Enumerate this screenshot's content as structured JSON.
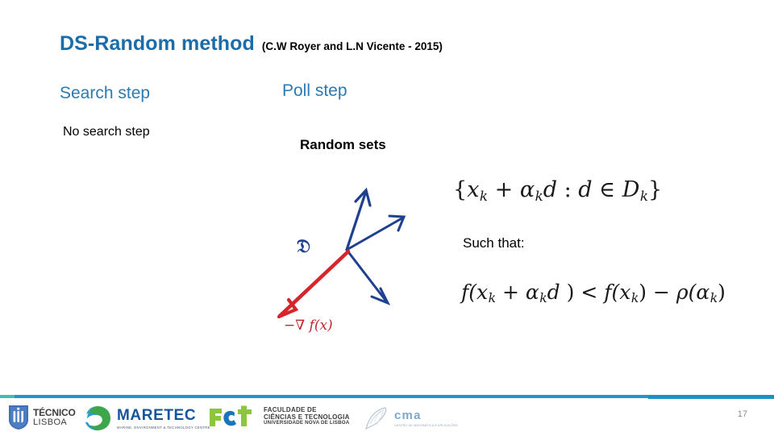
{
  "slide": {
    "title_main": "DS-Random method",
    "title_citation": "(C.W Royer and L.N Vicente - 2015)",
    "page_number": "17",
    "accent_blue": "#1b6ca8",
    "heading_blue": "#2b7ab0",
    "rule_teal": "#3fbfae",
    "rule_blue": "#2196c8",
    "arrow_blue": "#1f3f8f",
    "arrow_red": "#c0272d"
  },
  "columns": {
    "search": {
      "heading": "Search step",
      "body": "No search step"
    },
    "poll": {
      "heading": "Poll step",
      "body": "Random sets"
    }
  },
  "diagram": {
    "set_label": "𝔇",
    "gradient_label_prefix": "−∇",
    "gradient_label_fn": "f(x)",
    "arrow_count": 4,
    "red_arrow_direction": "down-left",
    "blue_arrow_directions": [
      "up",
      "up-right",
      "down-right"
    ]
  },
  "math": {
    "set_formula": {
      "open_brace": "{",
      "x": "x",
      "x_sub": "k",
      "plus": " + ",
      "alpha": "α",
      "alpha_sub": "k",
      "d": "d",
      "colon": " : ",
      "d2": "d",
      "in": " ∈ ",
      "D": "D",
      "D_sub": "k",
      "close_brace": "}",
      "plain": "{xₖ + αₖd : d ∈ Dₖ}"
    },
    "such_that_label": "Such that:",
    "sufficient_decrease": {
      "f1": "f(",
      "x": "x",
      "x_sub": "k",
      "plus": " + ",
      "alpha": "α",
      "alpha_sub": "k",
      "d": "d",
      "close1": " )",
      "lt": " < ",
      "f2": "f(",
      "x2": "x",
      "x2_sub": "k",
      "close2": ")",
      "minus": " − ",
      "rho": "ρ(",
      "alpha2": "α",
      "alpha2_sub": "k",
      "close3": ")",
      "plain": "f(xₖ + αₖd ) < f(xₖ) − ρ(αₖ)"
    }
  },
  "footer": {
    "logos": [
      {
        "name": "ist-tecnico-lisboa",
        "line1": "TÉCNICO",
        "line2": "LISBOA"
      },
      {
        "name": "maretec",
        "wordmark": "MARETEC",
        "tagline": "MARINE, ENVIRONMENT & TECHNOLOGY CENTRE"
      },
      {
        "name": "fct-unl",
        "wordmark": "FCT",
        "line1": "FACULDADE DE",
        "line2": "CIÊNCIAS E TECNOLOGIA",
        "line3": "UNIVERSIDADE NOVA DE LISBOA"
      },
      {
        "name": "cma",
        "wordmark": "cma",
        "tagline": "CENTRO DE MATEMÁTICA E APLICAÇÕES"
      }
    ]
  }
}
